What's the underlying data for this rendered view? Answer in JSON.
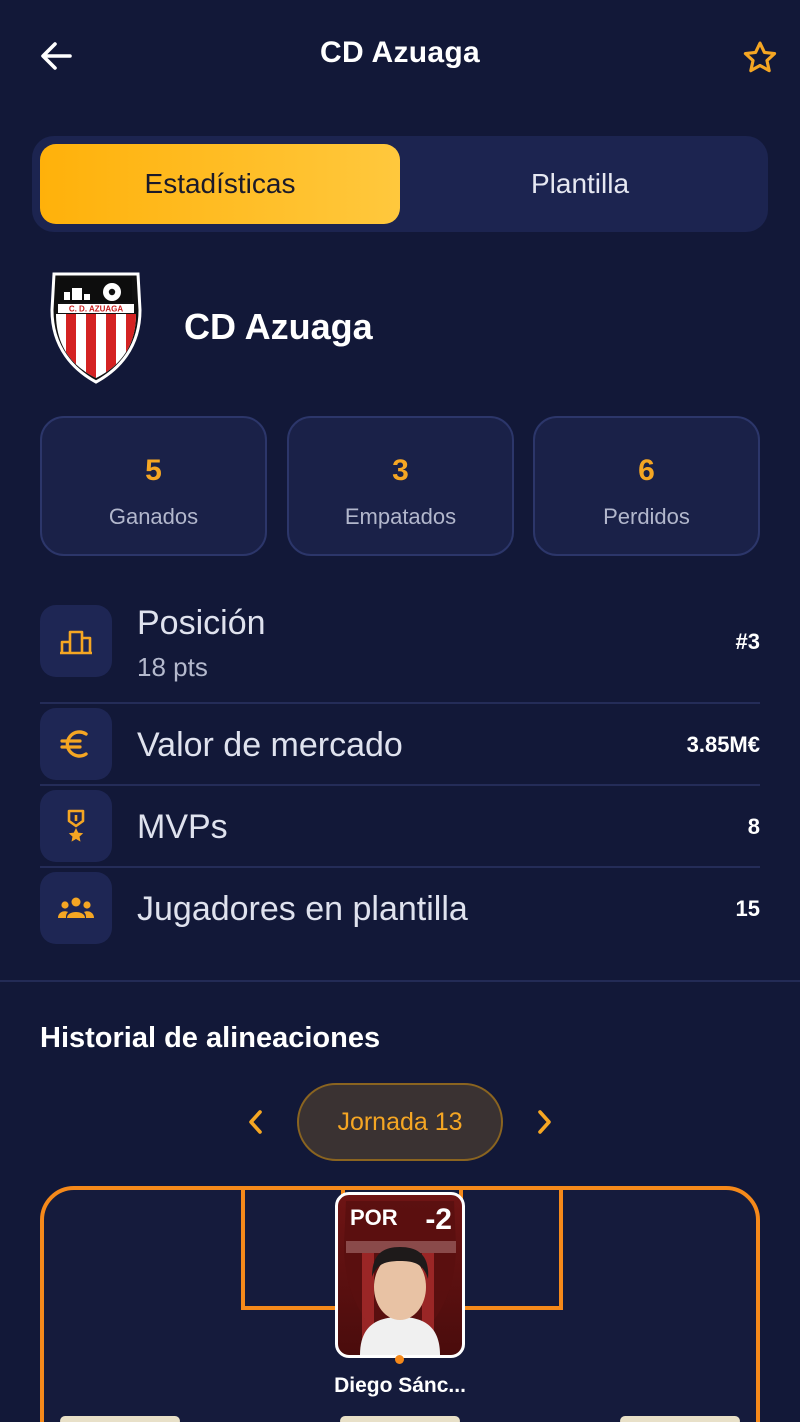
{
  "header": {
    "title": "CD Azuaga",
    "back_icon": "arrow-left-icon",
    "favorite_icon": "star-outline-icon"
  },
  "tabs": [
    {
      "label": "Estadísticas",
      "active": true
    },
    {
      "label": "Plantilla",
      "active": false
    }
  ],
  "club": {
    "name": "CD Azuaga",
    "crest_text": "C. D. AZUAGA"
  },
  "record": [
    {
      "value": "5",
      "label": "Ganados"
    },
    {
      "value": "3",
      "label": "Empatados"
    },
    {
      "value": "6",
      "label": "Perdidos"
    }
  ],
  "info": [
    {
      "label": "Posición",
      "sub": "18 pts",
      "value": "#3",
      "icon": "podium-icon"
    },
    {
      "label": "Valor de mercado",
      "value": "3.85M€",
      "icon": "euro-icon"
    },
    {
      "label": "MVPs",
      "value": "8",
      "icon": "medal-icon"
    },
    {
      "label": "Jugadores en plantilla",
      "value": "15",
      "icon": "group-icon"
    }
  ],
  "lineups": {
    "title": "Historial de alineaciones",
    "round_label": "Jornada 13",
    "prev_icon": "chevron-left-icon",
    "next_icon": "chevron-right-icon",
    "players": [
      {
        "position": "POR",
        "score": "-2",
        "name": "Diego Sánc..."
      }
    ]
  },
  "colors": {
    "background": "#121838",
    "accent": "#f5a623",
    "pitch_line": "#f5891a",
    "card": "#1a2148"
  }
}
